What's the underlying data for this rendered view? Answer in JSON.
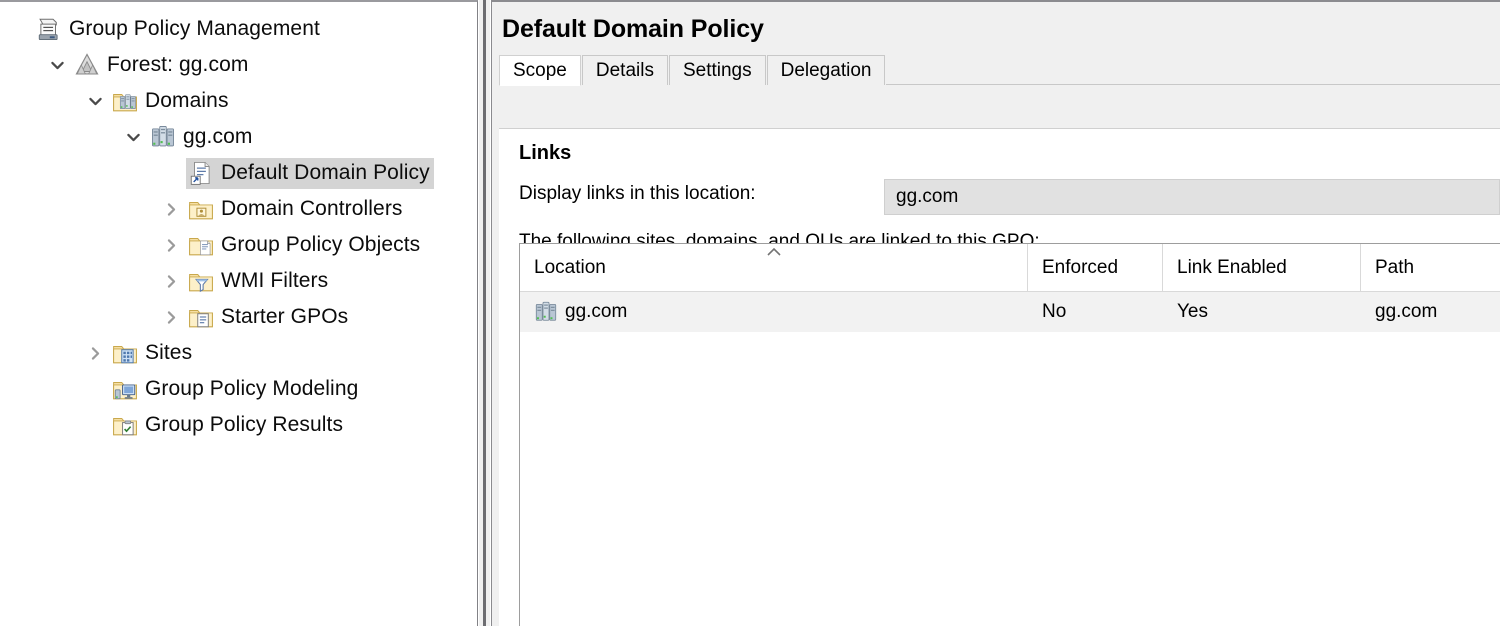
{
  "window": {
    "app_title": "Group Policy Management"
  },
  "tree": {
    "items": [
      {
        "label": "Group Policy Management",
        "icon": "gpmc-console-icon",
        "indent": 0,
        "expander": "none",
        "selected": false
      },
      {
        "label": "Forest: gg.com",
        "icon": "forest-icon",
        "indent": 1,
        "expander": "expanded",
        "selected": false
      },
      {
        "label": "Domains",
        "icon": "domains-folder-icon",
        "indent": 2,
        "expander": "expanded",
        "selected": false
      },
      {
        "label": "gg.com",
        "icon": "domain-icon",
        "indent": 3,
        "expander": "expanded",
        "selected": false
      },
      {
        "label": "Default Domain Policy",
        "icon": "gpo-link-icon",
        "indent": 4,
        "expander": "none",
        "selected": true
      },
      {
        "label": "Domain Controllers",
        "icon": "ou-folder-icon",
        "indent": 4,
        "expander": "collapsed",
        "selected": false
      },
      {
        "label": "Group Policy Objects",
        "icon": "gpo-folder-icon",
        "indent": 4,
        "expander": "collapsed",
        "selected": false
      },
      {
        "label": "WMI Filters",
        "icon": "wmi-filter-folder-icon",
        "indent": 4,
        "expander": "collapsed",
        "selected": false
      },
      {
        "label": "Starter GPOs",
        "icon": "starter-gpo-folder-icon",
        "indent": 4,
        "expander": "collapsed",
        "selected": false
      },
      {
        "label": "Sites",
        "icon": "sites-folder-icon",
        "indent": 2,
        "expander": "collapsed",
        "selected": false
      },
      {
        "label": "Group Policy Modeling",
        "icon": "gp-modeling-icon",
        "indent": 2,
        "expander": "none",
        "selected": false
      },
      {
        "label": "Group Policy Results",
        "icon": "gp-results-icon",
        "indent": 2,
        "expander": "none",
        "selected": false
      }
    ]
  },
  "detail": {
    "title": "Default Domain Policy",
    "tabs": [
      {
        "label": "Scope",
        "active": true
      },
      {
        "label": "Details",
        "active": false
      },
      {
        "label": "Settings",
        "active": false
      },
      {
        "label": "Delegation",
        "active": false
      }
    ],
    "scope": {
      "links_heading": "Links",
      "display_links_label": "Display links in this location:",
      "location_value": "gg.com",
      "linked_description": "The following sites, domains, and OUs are linked to this GPO:",
      "table": {
        "columns": [
          "Location",
          "Enforced",
          "Link Enabled",
          "Path"
        ],
        "sorted_column": "Location",
        "sort_direction": "ascending",
        "rows": [
          {
            "location": "gg.com",
            "enforced": "No",
            "link_enabled": "Yes",
            "path": "gg.com",
            "icon": "domain-icon"
          }
        ]
      }
    }
  },
  "colors": {
    "selection": "#d4d4d4",
    "row_alt": "#f2f2f2",
    "combo_bg": "#e1e1e1",
    "pane_bg": "#f0f0f0",
    "border": "#9d9d9d"
  }
}
